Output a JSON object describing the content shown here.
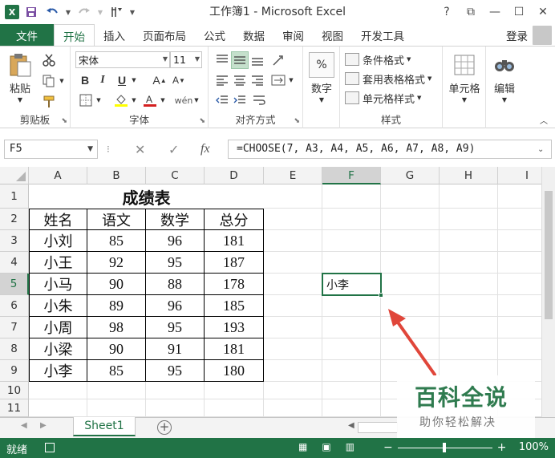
{
  "titlebar": {
    "title": "工作簿1 - Microsoft Excel",
    "app_logo": "X",
    "controls": [
      "?",
      "⧉",
      "—",
      "☐",
      "✕"
    ]
  },
  "tabs": {
    "file": "文件",
    "items": [
      "开始",
      "插入",
      "页面布局",
      "公式",
      "数据",
      "审阅",
      "视图",
      "开发工具"
    ],
    "active_index": 0,
    "login": "登录"
  },
  "ribbon": {
    "clipboard": {
      "label": "剪贴板",
      "paste": "粘贴"
    },
    "font": {
      "label": "字体",
      "name": "宋体",
      "size": "11",
      "bold": "B",
      "italic": "I",
      "underline": "U",
      "grow": "A",
      "shrink": "A"
    },
    "alignment": {
      "label": "对齐方式"
    },
    "number": {
      "label": "数字",
      "icon_text": "%"
    },
    "styles": {
      "label": "样式",
      "conditional": "条件格式",
      "table": "套用表格格式",
      "cell": "单元格样式"
    },
    "cells": {
      "label": "单元格"
    },
    "editing": {
      "label": "编辑"
    }
  },
  "formula_bar": {
    "name_box": "F5",
    "formula": "=CHOOSE(7, A3, A4, A5, A6, A7, A8, A9)"
  },
  "grid": {
    "columns": [
      "A",
      "B",
      "C",
      "D",
      "E",
      "F",
      "G",
      "H",
      "I"
    ],
    "rows": [
      "1",
      "2",
      "3",
      "4",
      "5",
      "6",
      "7",
      "8",
      "9",
      "10",
      "11"
    ],
    "selected_column": "F",
    "selected_row": "5",
    "active_cell_value": "小李"
  },
  "table": {
    "title": "成绩表",
    "headers": [
      "姓名",
      "语文",
      "数学",
      "总分"
    ],
    "rows": [
      [
        "小刘",
        "85",
        "96",
        "181"
      ],
      [
        "小王",
        "92",
        "95",
        "187"
      ],
      [
        "小马",
        "90",
        "88",
        "178"
      ],
      [
        "小朱",
        "89",
        "96",
        "185"
      ],
      [
        "小周",
        "98",
        "95",
        "193"
      ],
      [
        "小梁",
        "90",
        "91",
        "181"
      ],
      [
        "小李",
        "85",
        "95",
        "180"
      ]
    ]
  },
  "sheets": {
    "tabs": [
      "Sheet1"
    ],
    "active": "Sheet1"
  },
  "status": {
    "ready": "就绪",
    "zoom": "100%"
  },
  "watermark": {
    "title": "百科全说",
    "subtitle": "助你轻松解决"
  },
  "colors": {
    "accent": "#217346",
    "arrow": "#e0463a"
  }
}
